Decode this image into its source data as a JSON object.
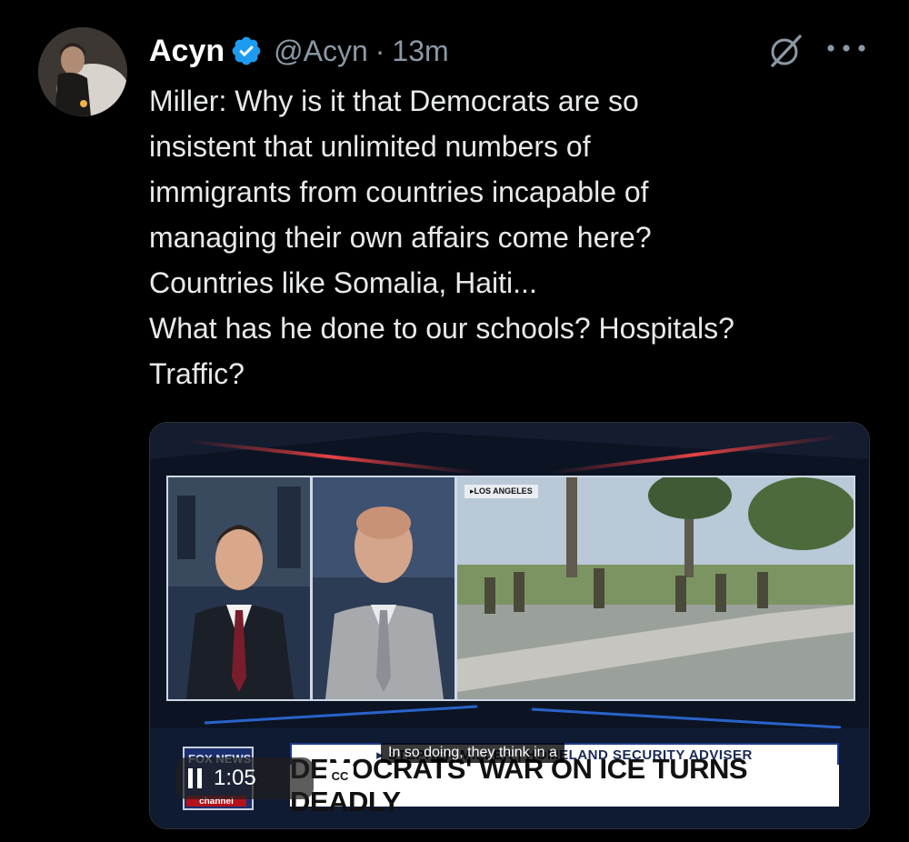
{
  "author": {
    "display_name": "Acyn",
    "handle": "@Acyn",
    "separator": "·",
    "time_ago": "13m",
    "verified": true,
    "verified_color": "#1d9bf0"
  },
  "icons": {
    "grok": "grok-icon",
    "more": "more-icon",
    "verified": "verified-badge-icon",
    "pause": "pause-icon"
  },
  "tweet": {
    "lines": [
      "Miller: Why is it that Democrats are so",
      "insistent that unlimited numbers of",
      "immigrants from countries incapable of",
      "managing their own affairs come here?",
      "Countries like Somalia, Haiti...",
      "What has he done to our schools? Hospitals?",
      "Traffic?"
    ]
  },
  "video": {
    "location_tag": "▸LOS ANGELES",
    "sub_banner": "▸ STEPHEN MILLER | HOMELAND SECURITY ADVISER",
    "headline": "DEMOCRATS' WAR ON ICE TURNS DEADLY",
    "logo_top": "FOX NEWS",
    "logo_bottom": "channel",
    "caption": "In so doing, they think in a",
    "duration": "1:05",
    "cc_label": "CC"
  }
}
